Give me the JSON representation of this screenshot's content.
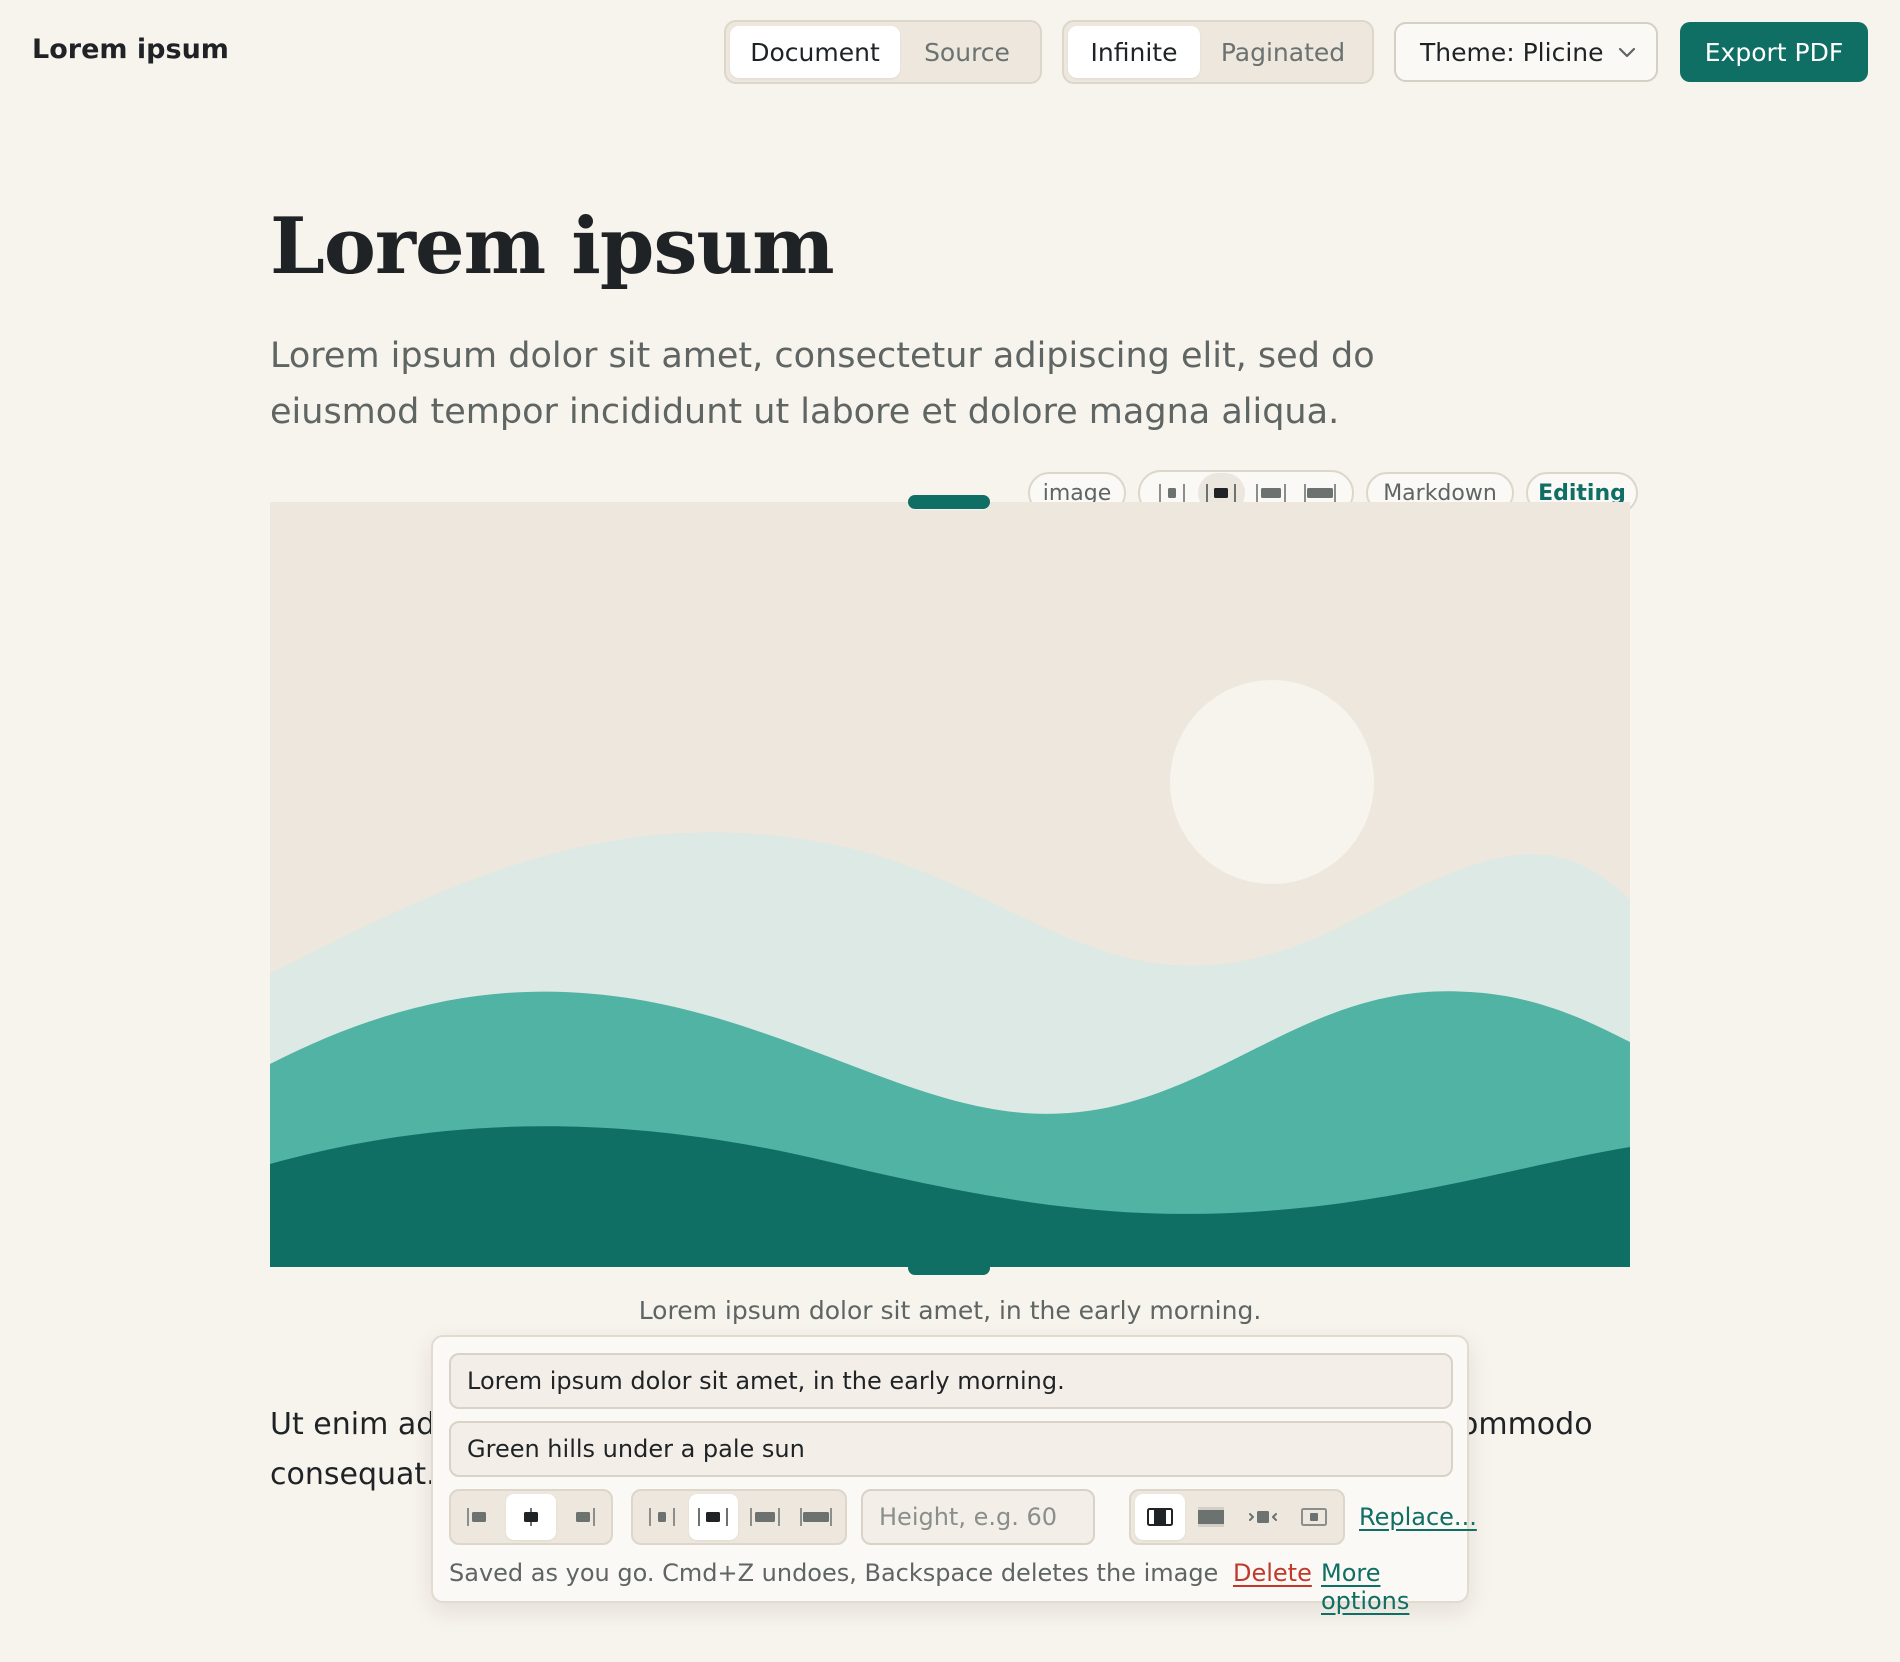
{
  "app": {
    "title": "Lorem ipsum"
  },
  "view_toggle": {
    "items": [
      "Document",
      "Source"
    ],
    "active": "Document"
  },
  "layout_toggle": {
    "items": [
      "Infinite",
      "Paginated"
    ],
    "active": "Infinite"
  },
  "theme": {
    "label": "Theme: Plicine"
  },
  "export": {
    "label": "Export PDF"
  },
  "document": {
    "title": "Lorem ipsum",
    "lead": "Lorem ipsum dolor sit amet, consectetur adipiscing elit, sed do eiusmod tempor incididunt ut labore et dolore magna aliqua.",
    "body_visible_start": "Ut enim ad r",
    "body_visible_end": "ommodo",
    "body_line2": "consequat."
  },
  "image_toolbar": {
    "type_chip": "image",
    "markdown_chip": "Markdown",
    "editing_chip": "Editing",
    "width_options": [
      "narrow",
      "medium",
      "wide",
      "full"
    ],
    "width_active": "medium"
  },
  "figure": {
    "caption": "Lorem ipsum dolor sit amet, in the early morning.",
    "colors": {
      "sky": "#ede7dd",
      "sun": "#f7f3ed",
      "hill_light": "#dce9e4",
      "hill_mid": "#50b3a4",
      "hill_dark": "#0f6f64"
    }
  },
  "popover": {
    "caption_value": "Lorem ipsum dolor sit amet, in the early morning.",
    "alt_value": "Green hills under a pale sun",
    "align_options": [
      "left",
      "center",
      "right"
    ],
    "align_active": "center",
    "width_options": [
      "narrow",
      "medium",
      "wide",
      "full"
    ],
    "width_active": "medium",
    "height_placeholder": "Height, e.g. 60",
    "fit_options": [
      "contain",
      "cover",
      "stretch",
      "original"
    ],
    "fit_active": "contain",
    "replace_label": "Replace...",
    "hint": "Saved as you go. Cmd+Z undoes, Backspace deletes the image",
    "delete_label": "Delete",
    "more_label": "More options"
  },
  "accent_color": "#0f6f64"
}
